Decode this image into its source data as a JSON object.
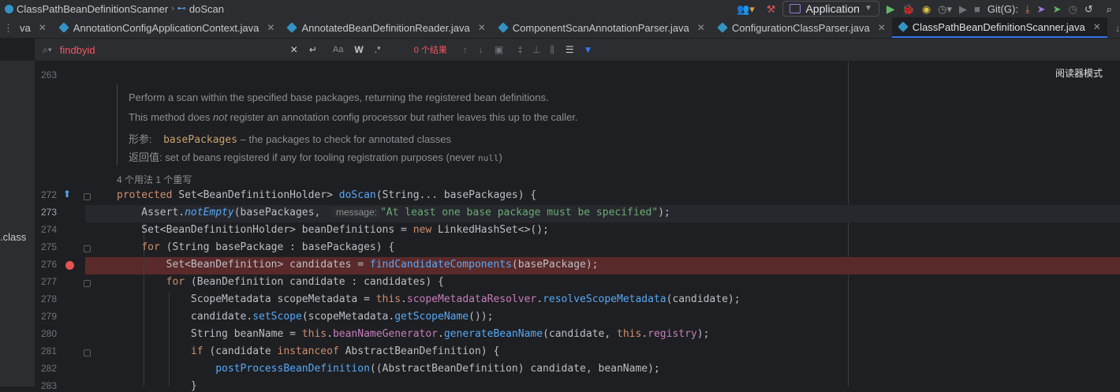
{
  "nav": {
    "breadcrumbs": [
      "ClassPathBeanDefinitionScanner",
      "doScan"
    ],
    "run_config": "Application",
    "git_label": "Git(G):"
  },
  "tabs": [
    {
      "label": "va",
      "active": false
    },
    {
      "label": "AnnotationConfigApplicationContext.java",
      "active": false
    },
    {
      "label": "AnnotatedBeanDefinitionReader.java",
      "active": false
    },
    {
      "label": "ComponentScanAnnotationParser.java",
      "active": false
    },
    {
      "label": "ConfigurationClassParser.java",
      "active": false
    },
    {
      "label": "ClassPathBeanDefinitionScanner.java",
      "active": true
    }
  ],
  "sidebar": {
    "class_label": ".class"
  },
  "search": {
    "value": "findbyid",
    "case_label": "Aa",
    "word_label": "W",
    "regex_label": ".*",
    "result_count": "0 个结果"
  },
  "editor": {
    "reader_mode": "阅读器模式",
    "doc": {
      "line1": "Perform a scan within the specified base packages, returning the registered bean definitions.",
      "line2_a": "This method does ",
      "line2_em": "not",
      "line2_b": " register an annotation config processor but rather leaves this up to the caller.",
      "param_label": "形参:",
      "param_name": "basePackages",
      "param_desc": " – the packages to check for annotated classes",
      "return_label": "返回值:",
      "return_desc": " set of beans registered if any for tooling registration purposes (never ",
      "return_null": "null",
      "return_end": ")"
    },
    "usages": "4 个用法   1 个重写",
    "line_numbers": [
      "263",
      "272",
      "273",
      "274",
      "275",
      "276",
      "277",
      "278",
      "279",
      "280",
      "281",
      "282",
      "283"
    ],
    "breakpoint_line": "276",
    "current_line": "273",
    "param_hint": "message:"
  }
}
